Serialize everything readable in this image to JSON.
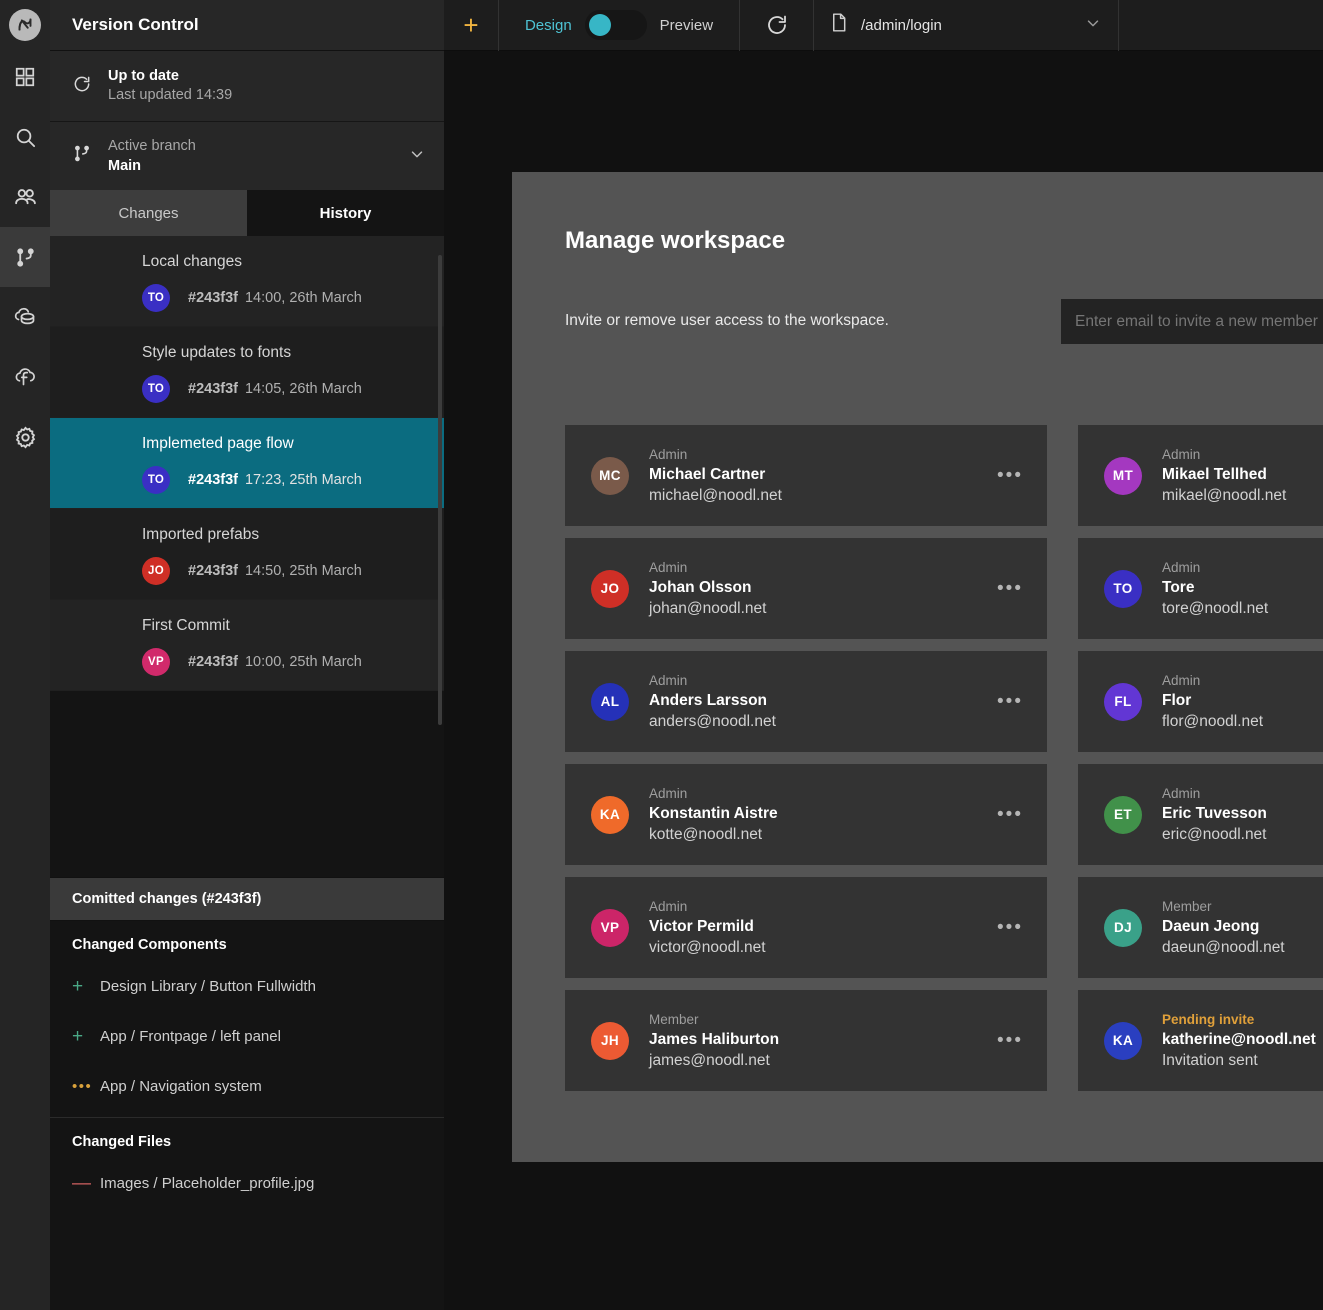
{
  "rail": {
    "logo": "noodl-logo-icon",
    "items": [
      {
        "name": "components-icon",
        "active": false
      },
      {
        "name": "search-icon",
        "active": false
      },
      {
        "name": "users-icon",
        "active": false
      },
      {
        "name": "version-control-icon",
        "active": true
      },
      {
        "name": "cloud-data-icon",
        "active": false
      },
      {
        "name": "cloud-functions-icon",
        "active": false
      },
      {
        "name": "settings-gear-icon",
        "active": false
      }
    ]
  },
  "version_control": {
    "title": "Version Control",
    "status": {
      "headline": "Up to date",
      "detail": "Last updated 14:39",
      "icon": "refresh-icon"
    },
    "branch": {
      "label": "Active branch",
      "value": "Main",
      "icon": "branch-icon",
      "chevron": "chevron-down-icon"
    },
    "tabs": [
      {
        "label": "Changes",
        "active": false
      },
      {
        "label": "History",
        "active": true
      }
    ],
    "commits": [
      {
        "title": "Local changes",
        "initials": "TO",
        "color": "#3a2fc4",
        "hash": "#243f3f",
        "meta": "14:00, 26th March",
        "selected": false
      },
      {
        "title": "Style updates to fonts",
        "initials": "TO",
        "color": "#3a2fc4",
        "hash": "#243f3f",
        "meta": "14:05, 26th March",
        "selected": false
      },
      {
        "title": "Implemeted page flow",
        "initials": "TO",
        "color": "#3a2fc4",
        "hash": "#243f3f",
        "meta": "17:23, 25th March",
        "selected": true
      },
      {
        "title": "Imported prefabs",
        "initials": "JO",
        "color": "#cf2f26",
        "hash": "#243f3f",
        "meta": "14:50, 25th March",
        "selected": false
      },
      {
        "title": "First Commit",
        "initials": "VP",
        "color": "#d12a6b",
        "hash": "#243f3f",
        "meta": "10:00, 25th March",
        "selected": false
      }
    ],
    "committed_header": "Comitted changes (#243f3f)",
    "changed_components_header": "Changed Components",
    "changed_components": [
      {
        "sign": "+",
        "type": "add",
        "label": "Design Library / Button Fullwidth"
      },
      {
        "sign": "+",
        "type": "add",
        "label": "App / Frontpage / left panel"
      },
      {
        "sign": "•••",
        "type": "mod",
        "label": "App / Navigation system"
      }
    ],
    "changed_files_header": "Changed Files",
    "changed_files": [
      {
        "sign": "—",
        "type": "del",
        "label": "Images / Placeholder_profile.jpg"
      }
    ]
  },
  "toolbar": {
    "add_label": "+",
    "design_label": "Design",
    "preview_label": "Preview",
    "toggle_state": "design",
    "refresh_icon": "refresh-icon",
    "route_icon": "document-icon",
    "route": "/admin/login",
    "route_chevron": "chevron-down-icon",
    "accent": "#37b6c6",
    "plus_color": "#f0b440"
  },
  "preview": {
    "title": "Manage workspace",
    "subtitle": "Invite or remove user access to the workspace.",
    "invite_placeholder": "Enter email to invite a new member",
    "invite_value": "",
    "menu_glyph": "•••",
    "users": [
      {
        "initials": "MC",
        "color": "#7a5a4a",
        "role": "Admin",
        "name": "Michael Cartner",
        "email": "michael@noodl.net",
        "pending": false
      },
      {
        "initials": "MT",
        "color": "#a438c0",
        "role": "Admin",
        "name": "Mikael Tellhed",
        "email": "mikael@noodl.net",
        "pending": false
      },
      {
        "initials": "JO",
        "color": "#cf2f26",
        "role": "Admin",
        "name": "Johan Olsson",
        "email": "johan@noodl.net",
        "pending": false
      },
      {
        "initials": "TO",
        "color": "#3a2fc4",
        "role": "Admin",
        "name": "Tore",
        "email": "tore@noodl.net",
        "pending": false
      },
      {
        "initials": "AL",
        "color": "#2531b8",
        "role": "Admin",
        "name": "Anders Larsson",
        "email": "anders@noodl.net",
        "pending": false
      },
      {
        "initials": "FL",
        "color": "#6236d4",
        "role": "Admin",
        "name": "Flor",
        "email": "flor@noodl.net",
        "pending": false
      },
      {
        "initials": "KA",
        "color": "#ef6a2a",
        "role": "Admin",
        "name": "Konstantin Aistre",
        "email": "kotte@noodl.net",
        "pending": false
      },
      {
        "initials": "ET",
        "color": "#41914a",
        "role": "Admin",
        "name": "Eric Tuvesson",
        "email": "eric@noodl.net",
        "pending": false
      },
      {
        "initials": "VP",
        "color": "#cc2568",
        "role": "Admin",
        "name": "Victor Permild",
        "email": "victor@noodl.net",
        "pending": false
      },
      {
        "initials": "DJ",
        "color": "#3aa189",
        "role": "Member",
        "name": "Daeun Jeong",
        "email": "daeun@noodl.net",
        "pending": false
      },
      {
        "initials": "JH",
        "color": "#ec5a33",
        "role": "Member",
        "name": "James Haliburton",
        "email": "james@noodl.net",
        "pending": false
      },
      {
        "initials": "KA",
        "color": "#2a3fc0",
        "role": "Pending invite",
        "name": "katherine@noodl.net",
        "email": "Invitation sent",
        "pending": true
      }
    ]
  }
}
